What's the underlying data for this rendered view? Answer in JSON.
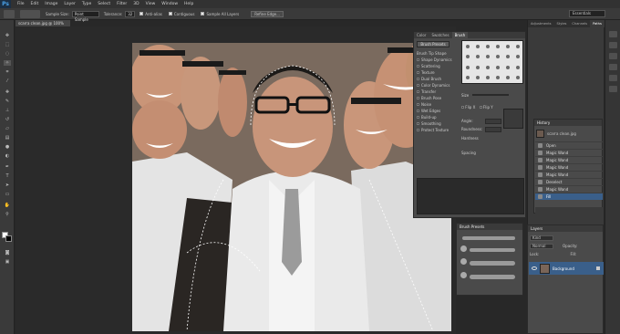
{
  "app": {
    "logo": "Ps"
  },
  "menu": [
    "File",
    "Edit",
    "Image",
    "Layer",
    "Type",
    "Select",
    "Filter",
    "3D",
    "View",
    "Window",
    "Help"
  ],
  "options": {
    "sample_size_label": "Sample Size:",
    "sample_size_value": "Point Sample",
    "tolerance_label": "Tolerance:",
    "tolerance_value": "32",
    "antialias_label": "Anti-alias",
    "contiguous_label": "Contiguous",
    "sample_all_label": "Sample All Layers",
    "refine_label": "Refine Edge..."
  },
  "workspace": "Essentials",
  "document": {
    "tab": "scarra clean.jpg @ 100% (RGB/8)"
  },
  "brush_panel": {
    "tabs": [
      "Color",
      "Swatches",
      "Brush"
    ],
    "active_tab": "Brush",
    "presets_button": "Brush Presets",
    "options": [
      "Brush Tip Shape",
      "Shape Dynamics",
      "Scattering",
      "Texture",
      "Dual Brush",
      "Color Dynamics",
      "Transfer",
      "Brush Pose",
      "Noise",
      "Wet Edges",
      "Build-up",
      "Smoothing",
      "Protect Texture"
    ],
    "size_label": "Size",
    "flip_x": "Flip X",
    "flip_y": "Flip Y",
    "angle_label": "Angle:",
    "roundness_label": "Roundness:",
    "hardness_label": "Hardness",
    "spacing_label": "Spacing"
  },
  "dock": {
    "tabs": [
      "Adjustments",
      "Styles",
      "Channels",
      "Paths"
    ],
    "active_tab": "Paths"
  },
  "history": {
    "title": "History",
    "snapshot": "scarra clean.jpg",
    "items": [
      "Open",
      "Magic Wand",
      "Magic Wand",
      "Magic Wand",
      "Magic Wand",
      "Deselect",
      "Magic Wand",
      "Fill"
    ],
    "selected_index": 7
  },
  "brush_presets": {
    "title": "Brush Presets"
  },
  "layers": {
    "title": "Layers",
    "kind_label": "Kind",
    "blend_mode": "Normal",
    "opacity_label": "Opacity:",
    "lock_label": "Lock:",
    "fill_label": "Fill:",
    "layer_name": "Background"
  },
  "colors": {
    "foreground": "#ffffff",
    "background": "#000000",
    "selection": "#3a5f8a"
  }
}
